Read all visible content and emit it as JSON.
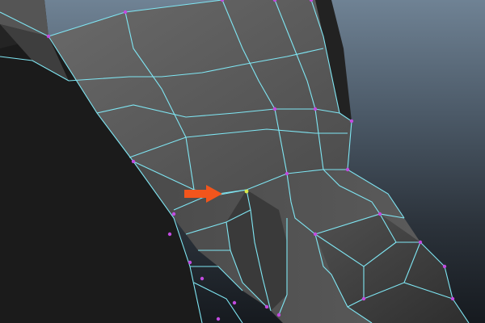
{
  "viewport": {
    "background_top": "#6f8294",
    "background_bottom": "#161a1f",
    "wireframe_color": "#7fe6f3",
    "vertex_color": "#c24be0",
    "selected_vertex_color": "#d8e84a",
    "annotation_arrow_color": "#f2551c",
    "annotation_icon": "right-arrow-icon"
  }
}
